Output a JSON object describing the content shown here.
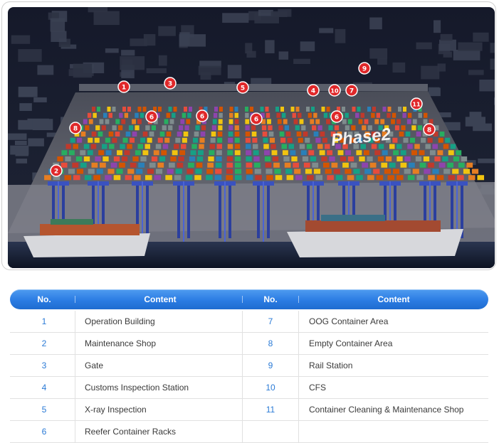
{
  "photo": {
    "phase_label": "Phase2",
    "markers": [
      "1",
      "2",
      "3",
      "4",
      "5",
      "6",
      "6",
      "6",
      "6",
      "7",
      "8",
      "8",
      "9",
      "10",
      "11"
    ]
  },
  "table": {
    "headers": {
      "no_left": "No.",
      "content_left": "Content",
      "no_right": "No.",
      "content_right": "Content"
    },
    "rows": [
      {
        "no_left": "1",
        "content_left": "Operation Building",
        "no_right": "7",
        "content_right": "OOG Container Area"
      },
      {
        "no_left": "2",
        "content_left": "Maintenance Shop",
        "no_right": "8",
        "content_right": "Empty Container Area"
      },
      {
        "no_left": "3",
        "content_left": "Gate",
        "no_right": "9",
        "content_right": "Rail Station"
      },
      {
        "no_left": "4",
        "content_left": "Customs Inspection Station",
        "no_right": "10",
        "content_right": "CFS"
      },
      {
        "no_left": "5",
        "content_left": "X-ray Inspection",
        "no_right": "11",
        "content_right": "Container Cleaning & Maintenance Shop"
      },
      {
        "no_left": "6",
        "content_left": "Reefer Container Racks",
        "no_right": "",
        "content_right": ""
      }
    ]
  },
  "colors": {
    "accent": "#2b7ce3",
    "marker": "#e0282a",
    "number": "#2a7ad6"
  }
}
